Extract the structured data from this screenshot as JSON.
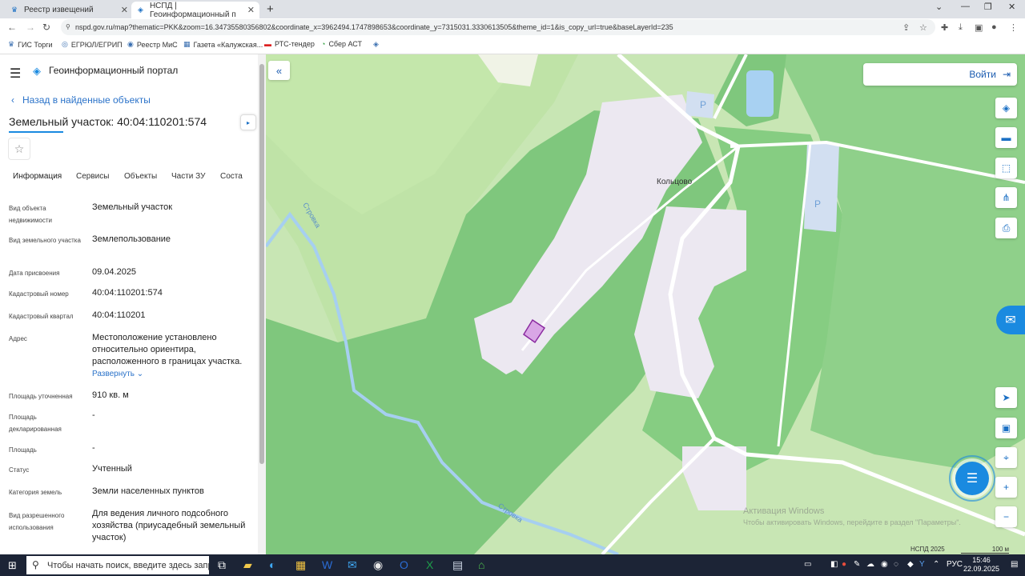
{
  "browser": {
    "tabs": [
      {
        "title": "Реестр извещений",
        "active": false
      },
      {
        "title": "НСПД | Геоинформационный п",
        "active": true
      }
    ],
    "new_tab_label": "+",
    "url": "nspd.gov.ru/map?thematic=PKK&zoom=16.34735580356802&coordinate_x=3962494.1747898653&coordinate_y=7315031.3330613505&theme_id=1&is_copy_url=true&baseLayerId=235",
    "bookmarks": [
      "ГИС Торги",
      "ЕГРЮЛ/ЕГРИП",
      "Реестр МиС",
      "Газета «Калужская...",
      "РТС-тендер",
      "Сбер АСТ"
    ]
  },
  "sidebar": {
    "portal_title": "Геоинформационный портал",
    "back_label": "Назад в найденные объекты",
    "object_title": "Земельный участок: 40:04:110201:574",
    "tabs": [
      "Информация",
      "Сервисы",
      "Объекты",
      "Части ЗУ",
      "Соста"
    ],
    "expand_label": "Развернуть",
    "rows": [
      {
        "label": "Вид объекта недвижимости",
        "value": "Земельный участок"
      },
      {
        "label": "Вид земельного участка",
        "value": "Землепользование"
      },
      {
        "label": "Дата присвоения",
        "value": "09.04.2025"
      },
      {
        "label": "Кадастровый номер",
        "value": "40:04:110201:574"
      },
      {
        "label": "Кадастровый квартал",
        "value": "40:04:110201"
      },
      {
        "label": "Адрес",
        "value": "Местоположение установлено относительно ориентира, расположенного в границах участка."
      },
      {
        "label": "Площадь уточненная",
        "value": "910 кв. м"
      },
      {
        "label": "Площадь декларированная",
        "value": "-"
      },
      {
        "label": "Площадь",
        "value": "-"
      },
      {
        "label": "Статус",
        "value": "Учтенный"
      },
      {
        "label": "Категория земель",
        "value": "Земли населенных пунктов"
      },
      {
        "label": "Вид разрешенного использования",
        "value": "Для ведения личного подсобного хозяйства (приусадебный земельный участок)"
      }
    ]
  },
  "map": {
    "login_label": "Войти",
    "village_label": "Кольцово",
    "river_label_1": "Стровка",
    "river_label_2": "Стровка",
    "parking_label": "P",
    "copyright": "НСПД 2025",
    "scale_label": "100 м",
    "activation_title": "Активация Windows",
    "activation_text": "Чтобы активировать Windows, перейдите в раздел \"Параметры\"."
  },
  "taskbar": {
    "search_placeholder": "Чтобы начать поиск, введите здесь запрос",
    "language": "РУС",
    "time": "15:46",
    "date": "22.09.2025"
  }
}
